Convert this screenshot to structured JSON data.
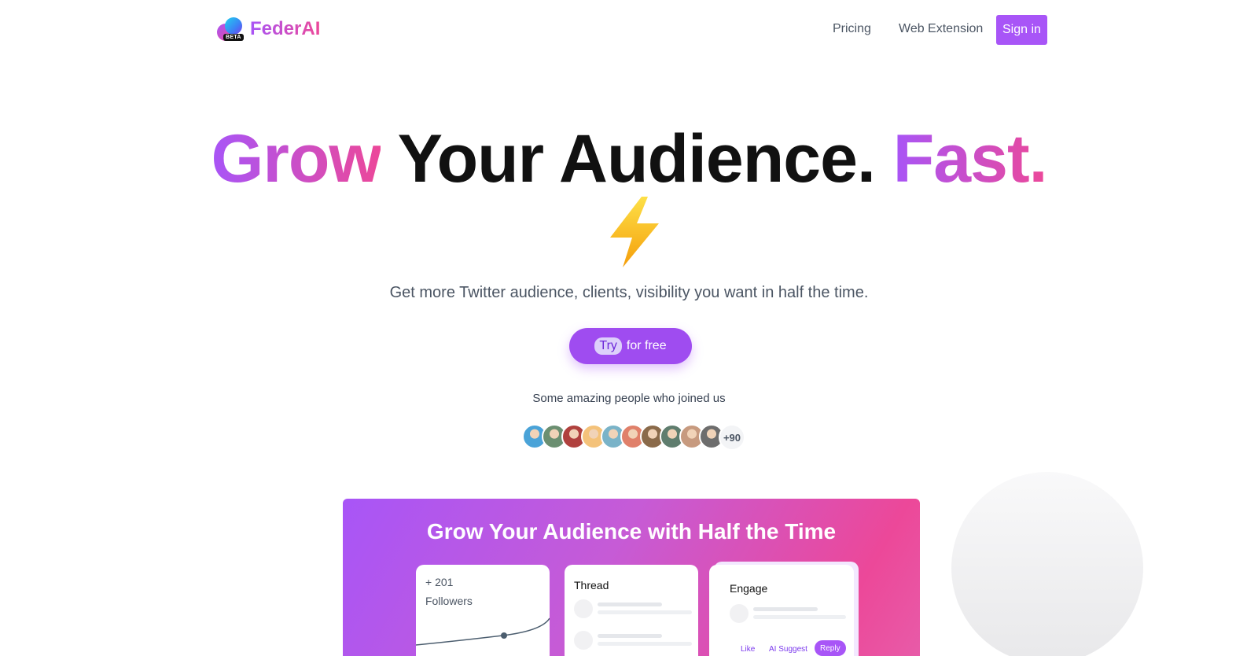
{
  "brand": {
    "name": "FederAI",
    "badge": "BETA"
  },
  "nav": {
    "pricing": "Pricing",
    "web_extension": "Web Extension",
    "sign_in": "Sign in"
  },
  "hero": {
    "title_grow": "Grow",
    "title_middle": "Your Audience.",
    "title_fast": "Fast.",
    "emoji": "lightning-bolt",
    "subtitle": "Get more Twitter audience, clients, visibility you want in half the time.",
    "cta_try": "Try",
    "cta_rest": "for free",
    "joined_text": "Some amazing people who joined us",
    "more_count": "+90"
  },
  "colors": {
    "accent": "#a855f7",
    "accent2": "#ec4899",
    "bolt": "#facc15"
  },
  "avatars": [
    "#4aa3d8",
    "#6b8f71",
    "#b0413e",
    "#f4c27a",
    "#7ab3c8",
    "#e0806a",
    "#8a6a4a",
    "#5f7d6e",
    "#c79a7f",
    "#6d6d6d"
  ],
  "preview": {
    "title": "Grow Your Audience with Half the Time",
    "followers_count": "+ 201",
    "followers_label": "Followers",
    "thread_label": "Thread",
    "engage_label": "Engage",
    "like": "Like",
    "ai_suggest": "AI Suggest",
    "reply": "Reply"
  }
}
